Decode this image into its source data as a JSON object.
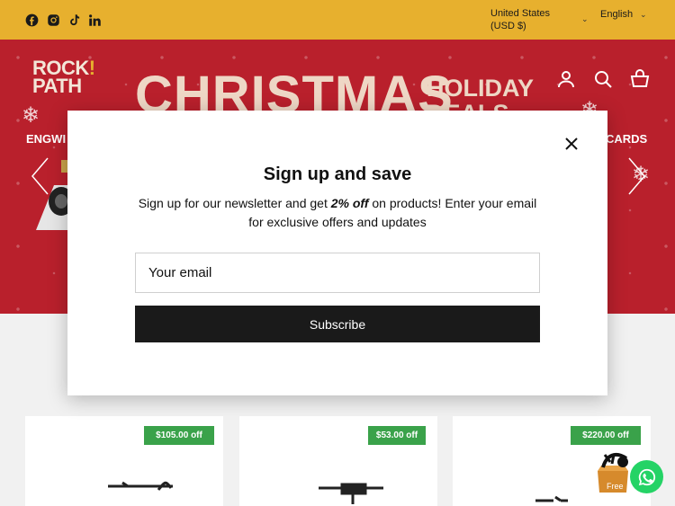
{
  "topbar": {
    "social": [
      "facebook-icon",
      "instagram-icon",
      "tiktok-icon",
      "linkedin-icon"
    ],
    "country_line1": "United States",
    "country_line2": "(USD $)",
    "language": "English"
  },
  "header": {
    "logo_line1": "ROCK",
    "logo_bang": "!",
    "logo_line2": "PATH",
    "icons": [
      "account-icon",
      "search-icon",
      "cart-icon"
    ]
  },
  "hero": {
    "title": "CHRISTMAS",
    "subtitle_line1": "HOLIDAY",
    "subtitle_line2": "DEALS",
    "nav_left": "ENGWI",
    "nav_right": "CARDS"
  },
  "modal": {
    "title": "Sign up and save",
    "text_before": "Sign up for our newsletter and get ",
    "text_bold": "2% off",
    "text_after": " on products! Enter your email for exclusive offers and updates",
    "email_placeholder": "Your email",
    "subscribe_label": "Subscribe"
  },
  "products": [
    {
      "badge": "$105.00 off"
    },
    {
      "badge": "$53.00 off"
    },
    {
      "badge": "$220.00 off"
    }
  ],
  "gift_label": "Free",
  "colors": {
    "topbar": "#e7b02e",
    "hero": "#b9202c",
    "badge": "#3aa24a",
    "subscribe": "#1a1a1a",
    "whatsapp": "#25d366"
  }
}
